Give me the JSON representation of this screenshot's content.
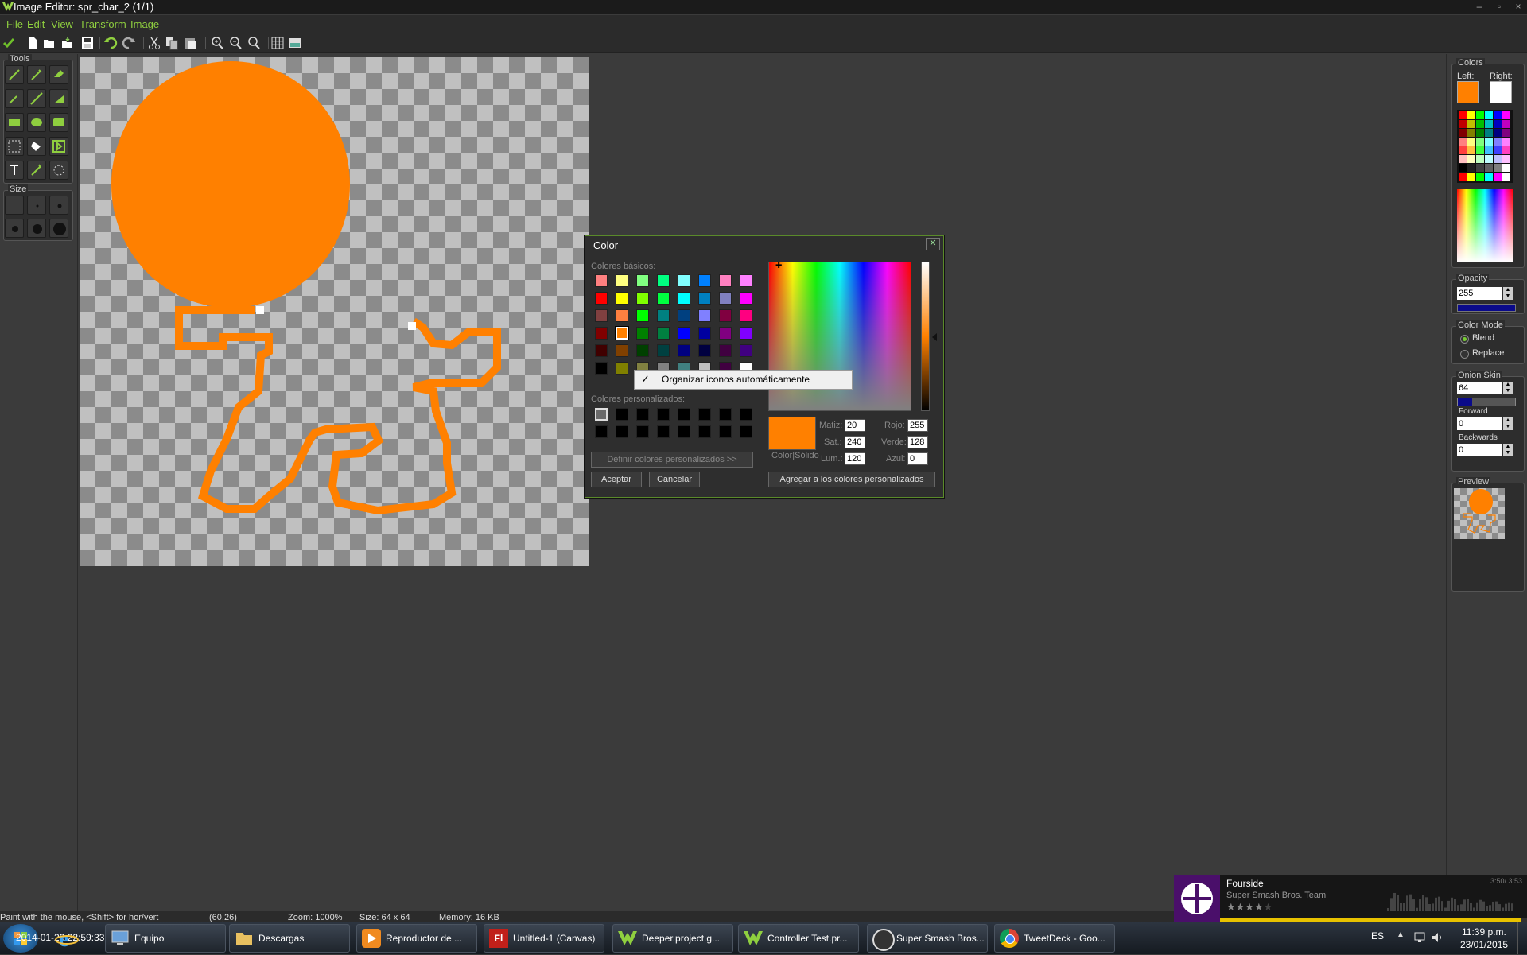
{
  "window": {
    "title": "Image Editor: spr_char_2 (1/1)"
  },
  "menu": [
    "File",
    "Edit",
    "View",
    "Transform",
    "Image"
  ],
  "toolbar_icons": [
    "check-icon",
    "new-icon",
    "open-icon",
    "import-icon",
    "save-icon",
    "undo-icon",
    "redo-icon",
    "cut-icon",
    "copy-icon",
    "paste-icon",
    "zoom-in-icon",
    "zoom-out-icon",
    "zoom-reset-icon",
    "grid-icon",
    "preview-icon"
  ],
  "tools": {
    "label": "Tools"
  },
  "size": {
    "label": "Size"
  },
  "colors_panel": {
    "title": "Colors",
    "left_label": "Left:",
    "right_label": "Right:",
    "left_color": "#ff8000",
    "right_color": "#ffffff"
  },
  "opacity": {
    "label": "Opacity",
    "value": "255"
  },
  "color_mode": {
    "label": "Color Mode",
    "blend": "Blend",
    "replace": "Replace",
    "selected": "Blend"
  },
  "onion_skin": {
    "label": "Onion Skin",
    "value": "64",
    "forward_label": "Forward",
    "forward_value": "0",
    "backwards_label": "Backwards",
    "backwards_value": "0"
  },
  "preview": {
    "label": "Preview"
  },
  "dialog": {
    "title": "Color",
    "basic_label": "Colores básicos:",
    "custom_label": "Colores personalizados:",
    "define_custom": "Definir colores personalizados >>",
    "ok": "Aceptar",
    "cancel": "Cancelar",
    "add_custom": "Agregar a los colores personalizados",
    "color_solid": "Color|Sólido",
    "hue_label": "Matiz:",
    "hue": "20",
    "sat_label": "Sat.:",
    "sat": "240",
    "lum_label": "Lum.:",
    "lum": "120",
    "red_label": "Rojo:",
    "red": "255",
    "green_label": "Verde:",
    "green": "128",
    "blue_label": "Azul:",
    "blue": "0",
    "selected_color": "#ff8000"
  },
  "context_menu": {
    "item": "Organizar iconos automáticamente",
    "checked": true
  },
  "status": {
    "hint": "Paint with the mouse, <Shift> for hor/vert",
    "coords": "(60,26)",
    "zoom": "Zoom: 1000%",
    "size": "Size: 64 x 64",
    "memory": "Memory: 16 KB",
    "overlay": "2014-01-23 22:59:33.0"
  },
  "taskbar": [
    {
      "label": "Equipo",
      "icon": "computer-icon"
    },
    {
      "label": "Descargas",
      "icon": "folder-icon"
    },
    {
      "label": "Reproductor de ...",
      "icon": "media-player-icon"
    },
    {
      "label": "Untitled-1 (Canvas)",
      "icon": "flash-icon"
    },
    {
      "label": "Deeper.project.g...",
      "icon": "gamemaker-icon"
    },
    {
      "label": "Controller Test.pr...",
      "icon": "gamemaker-icon"
    },
    {
      "label": "Super Smash Bros...",
      "icon": "winamp-icon"
    },
    {
      "label": "TweetDeck - Goo...",
      "icon": "chrome-icon"
    }
  ],
  "tray": {
    "lang": "ES",
    "time": "11:39 p.m.",
    "date": "23/01/2015"
  },
  "media": {
    "song": "Fourside",
    "artist": "Super Smash Bros. Team",
    "time": "3:50/ 3:53",
    "rating": 4,
    "progress": 0.98
  }
}
